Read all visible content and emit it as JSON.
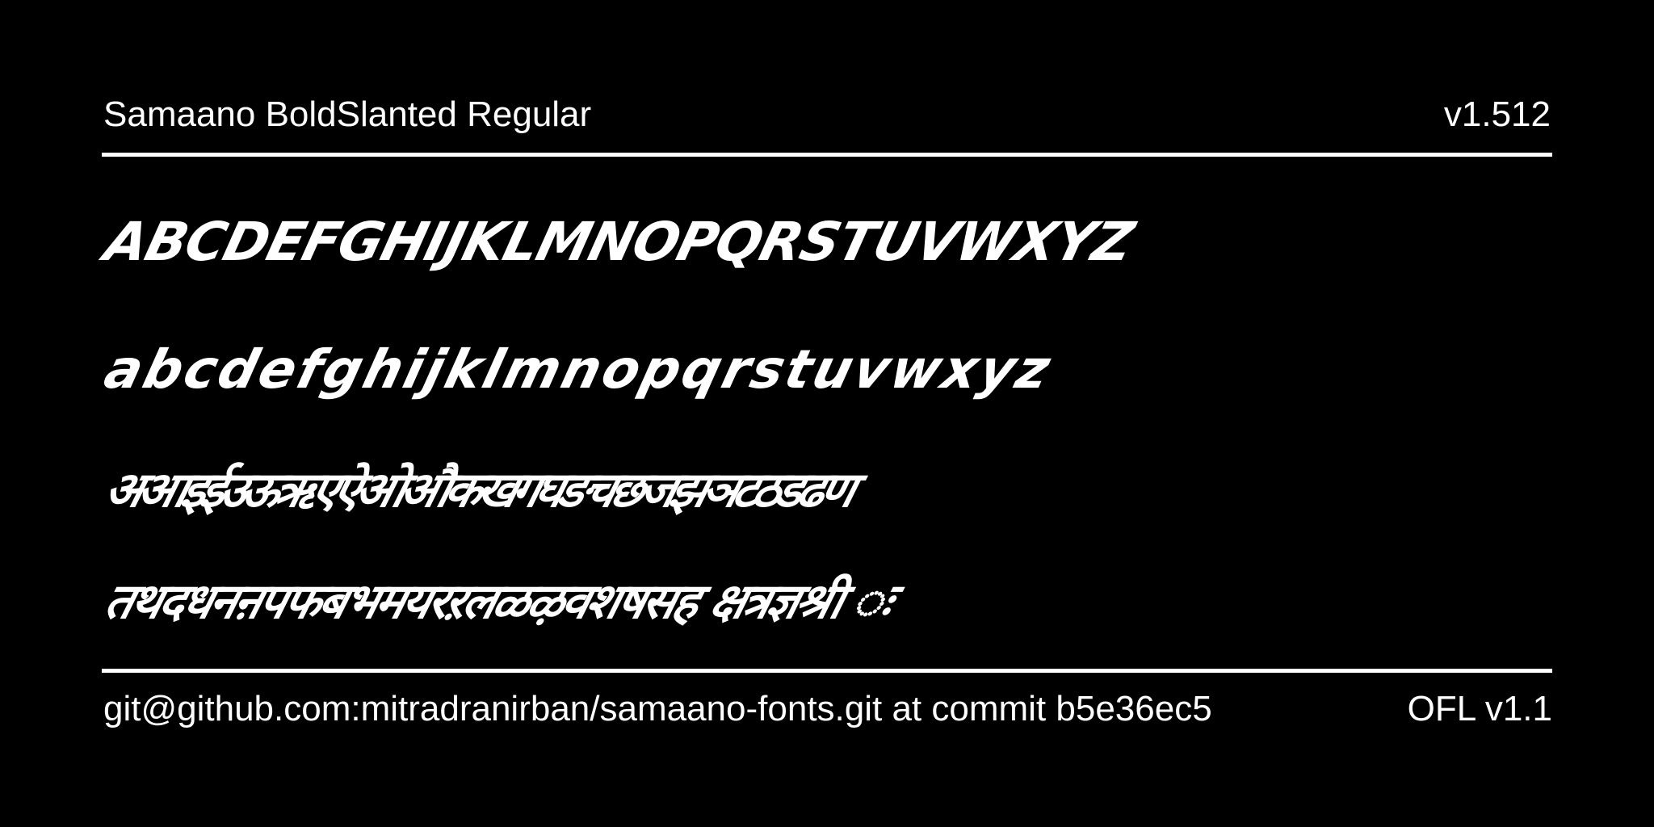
{
  "header": {
    "font_name": "Samaano BoldSlanted Regular",
    "version": "v1.512"
  },
  "samples": {
    "uppercase": "ABCDEFGHIJKLMNOPQRSTUVWXYZ",
    "lowercase": "abcdefghijklmnopqrstuvwxyz",
    "devanagari_vowels_consonants": "अआइईउऊऋएऐओऔकखगघङचछजझञटठडढण",
    "devanagari_consonants_signs": "तथदधनऩपफबभमयरऱलळऴवशषसह क्षत्रज्ञश्री ः"
  },
  "footer": {
    "source": "git@github.com:mitradranirban/samaano-fonts.git at commit b5e36ec5",
    "license": "OFL v1.1"
  },
  "colors": {
    "background": "#000000",
    "foreground": "#ffffff"
  }
}
